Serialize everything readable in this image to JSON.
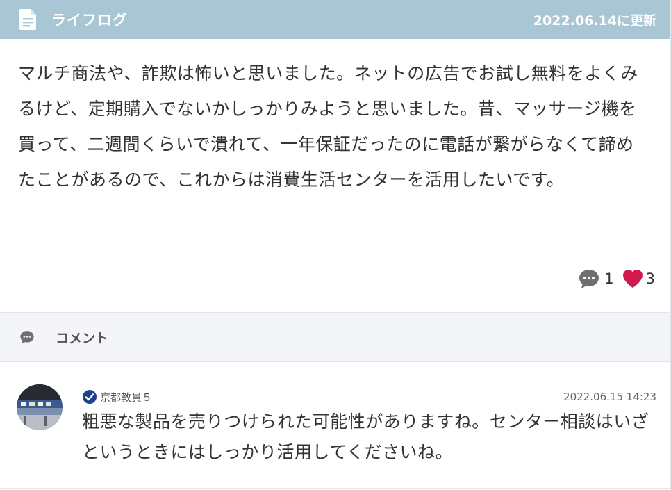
{
  "header": {
    "title": "ライフログ",
    "updated": "2022.06.14に更新",
    "icon": "document-icon"
  },
  "post": {
    "text": "マルチ商法や、詐欺は怖いと思いました。ネットの広告でお試し無料をよくみるけど、定期購入でないかしっかりみようと思いました。昔、マッサージ機を買って、二週間くらいで潰れて、一年保証だったのに電話が繋がらなくて諦めたことがあるので、これからは消費生活センターを活用したいです。"
  },
  "reactions": {
    "comments_count": "1",
    "likes_count": "3",
    "comment_icon": "speech-bubble-icon",
    "like_icon": "heart-icon",
    "like_color": "#d2194e",
    "comment_color": "#6f6f6f"
  },
  "comments_section": {
    "label": "コメント",
    "items": [
      {
        "user": "京都教員５",
        "date": "2022.06.15 14:23",
        "text": "粗悪な製品を売りつけられた可能性がありますね。センター相談はいざというときにはしっかり活用してくださいね。",
        "verified": true
      }
    ]
  },
  "colors": {
    "header_bg": "#a9c6d4",
    "section_bg": "#f3f5f8",
    "verified": "#1e3f8a"
  }
}
